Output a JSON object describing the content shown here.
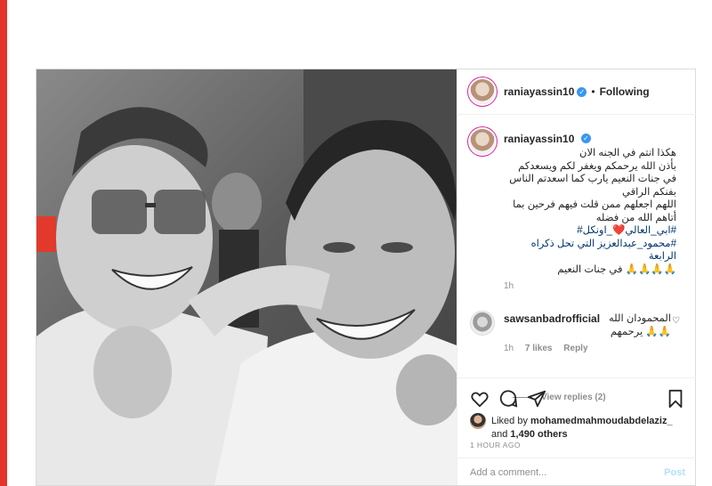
{
  "header": {
    "username": "raniayassin10",
    "follow_status": "Following",
    "dot": "•"
  },
  "caption": {
    "username": "raniayassin10",
    "lines": [
      "هكذا انتم في الجنه الان",
      "بأذن الله يرحمكم ويغفر لكم ويسعدكم",
      "في جنات النعيم يارب كما اسعدتم الناس",
      "بفنكم الراقي",
      "اللهم اجعلهم ممن قلت فيهم فرحين بما",
      "أتاهم الله من فضله"
    ],
    "hashtag1": "#ابي_العالي",
    "hashtag1_suffix": "❤️_اونكل#",
    "hashtag2": "#محمود_عبدالعزيز التي تحل ذكراه الرابعة",
    "last_line": "🙏🙏🙏🙏 في جنات النعيم",
    "time": "1h"
  },
  "comment": {
    "username": "sawsanbadrofficial",
    "text_line1": "المحمودان الله",
    "text_line2": "🙏🙏 يرحمهم",
    "time": "1h",
    "likes": "7 likes",
    "reply": "Reply",
    "view_replies": "View replies (2)"
  },
  "likes": {
    "prefix": "Liked by",
    "user": "mohamedmahmoudabdelaziz_",
    "and": "and",
    "count": "1,490 others"
  },
  "timestamp": "1 HOUR AGO",
  "add_comment": {
    "placeholder": "Add a comment...",
    "post_label": "Post"
  },
  "icons": [
    "heart-icon",
    "comment-icon",
    "share-icon",
    "bookmark-icon",
    "verified-icon"
  ],
  "colors": {
    "accent_red": "#e4342c",
    "link_blue": "#3897f0",
    "hashtag": "#00376b",
    "muted": "#8e8e8e"
  }
}
